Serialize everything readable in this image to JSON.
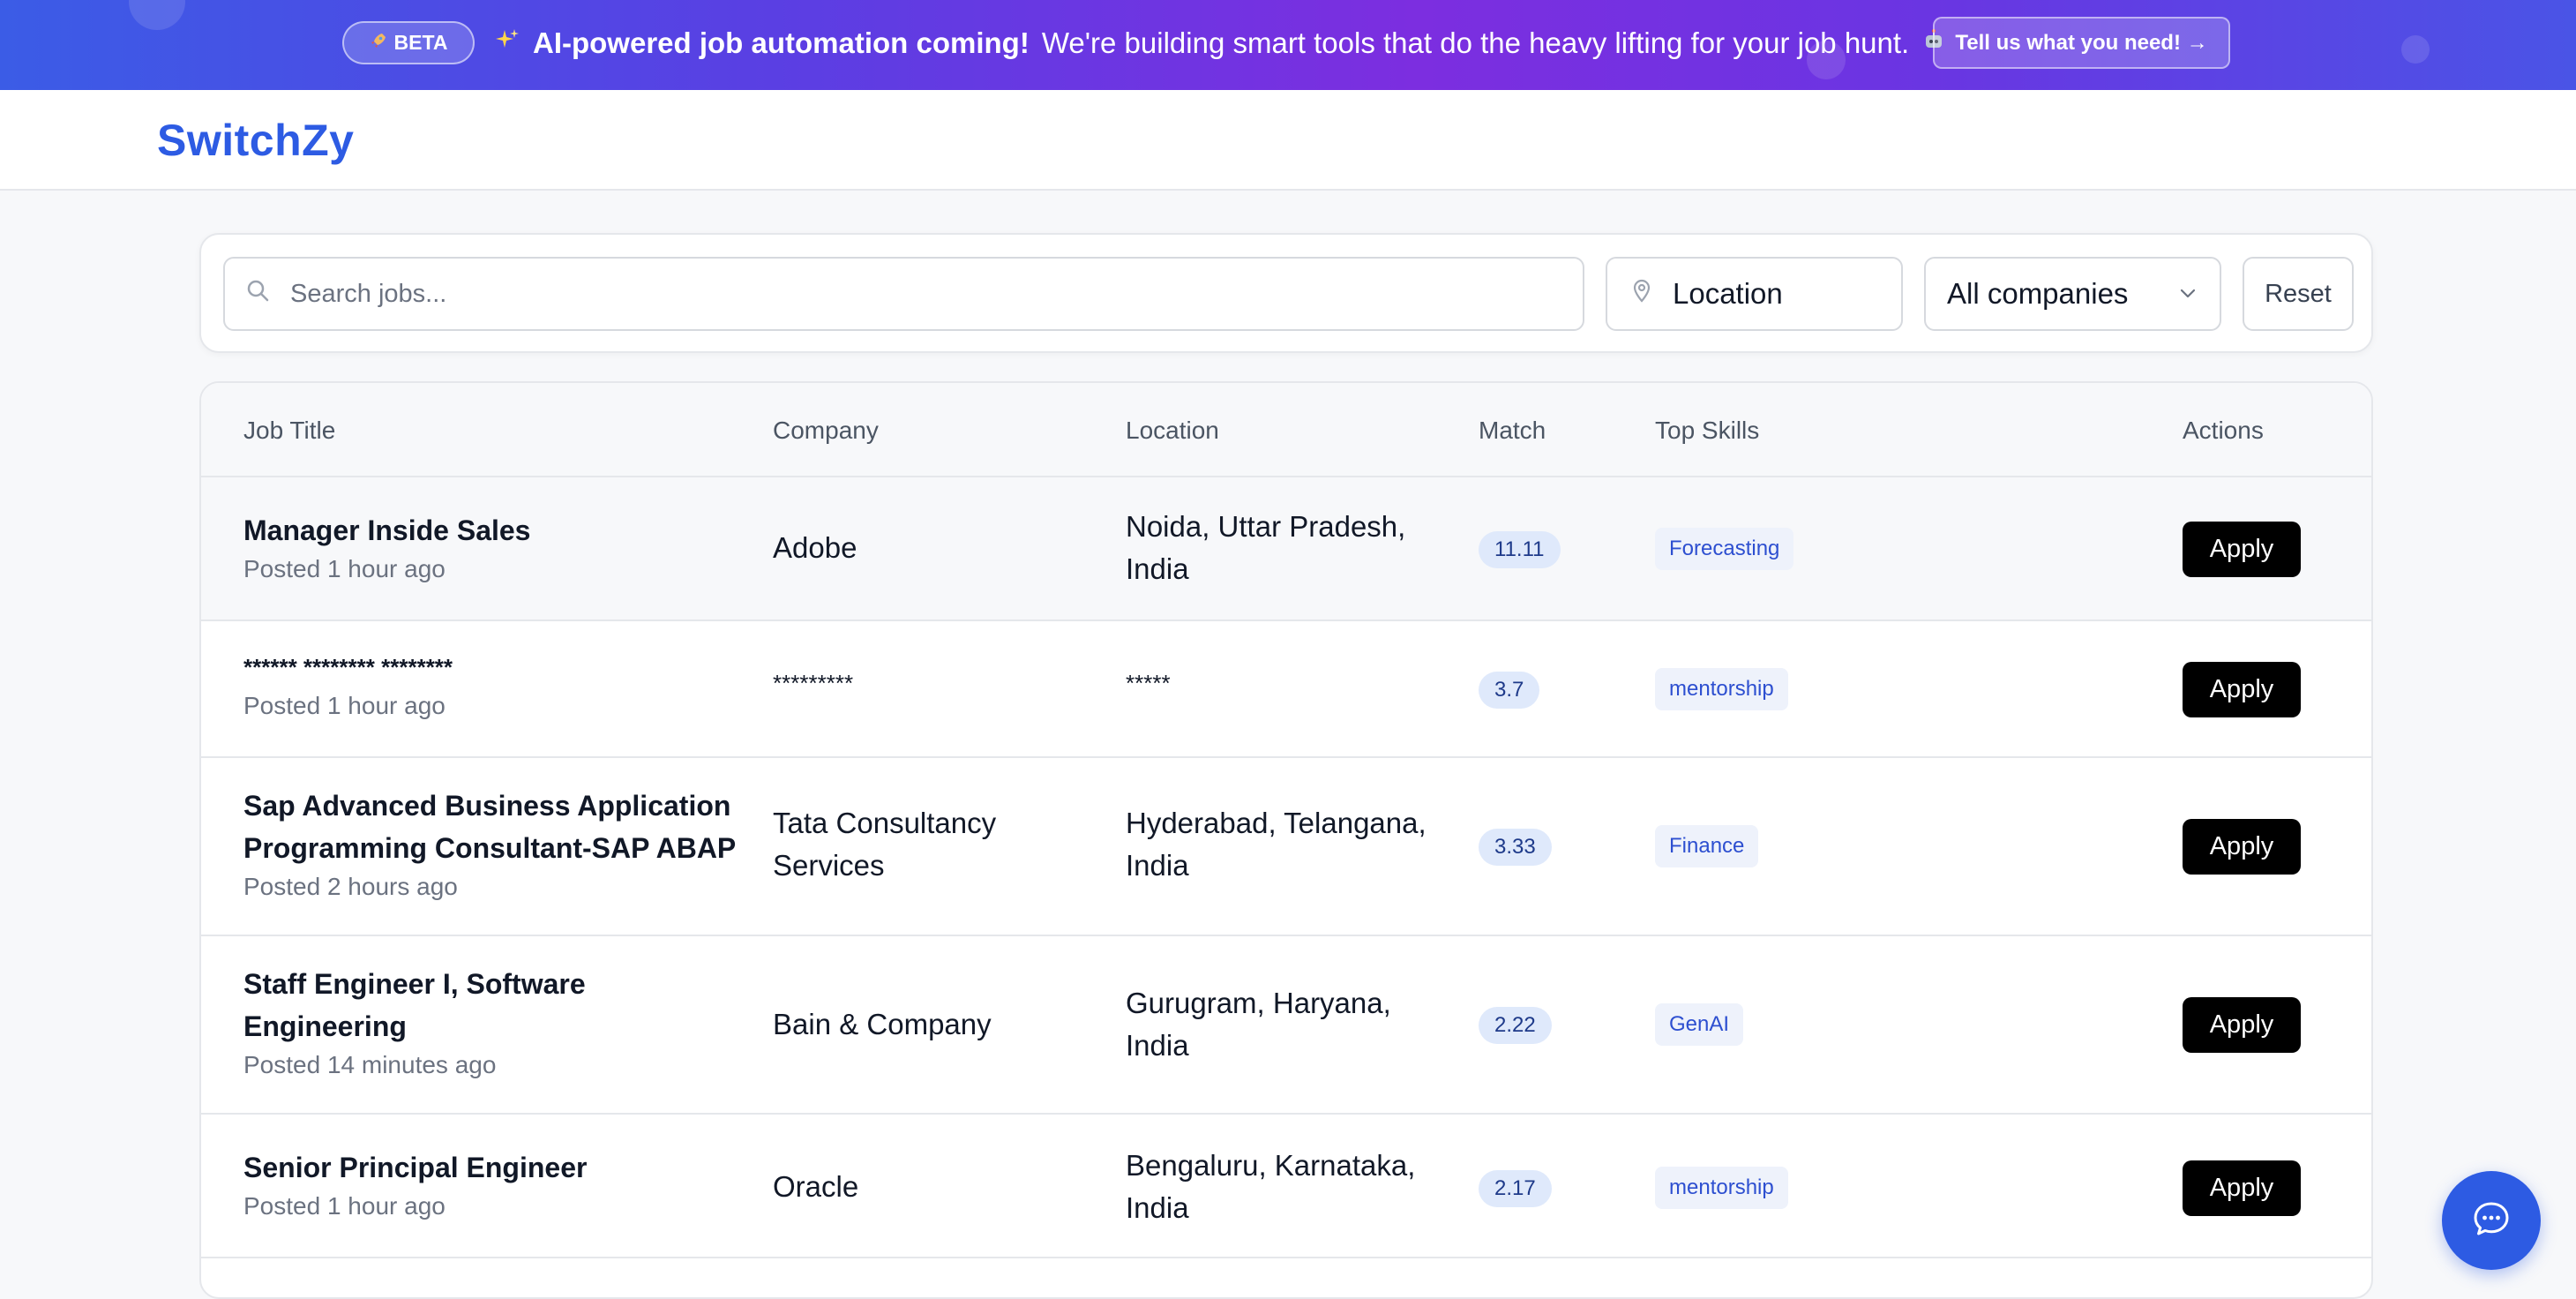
{
  "banner": {
    "beta_label": "BETA",
    "beta_icon": "rocket-icon",
    "sparkle_icon": "sparkles-icon",
    "headline": "AI-powered job automation coming!",
    "message": "We're building smart tools that do the heavy lifting for your job hunt.",
    "robot_icon": "robot-icon",
    "cta_label": "Tell us what you need! →"
  },
  "header": {
    "logo": "SwitchZy"
  },
  "filters": {
    "search_placeholder": "Search jobs...",
    "location_placeholder": "Location",
    "company_selected": "All companies",
    "reset_label": "Reset"
  },
  "table": {
    "columns": {
      "job_title": "Job Title",
      "company": "Company",
      "location": "Location",
      "match": "Match",
      "top_skills": "Top Skills",
      "actions": "Actions"
    },
    "rows": [
      {
        "title": "Manager Inside Sales",
        "posted": "Posted 1 hour ago",
        "company": "Adobe",
        "location": "Noida, Uttar Pradesh, India",
        "match": "11.11",
        "skill": "Forecasting",
        "action": "Apply"
      },
      {
        "title": "****** ******** ********",
        "posted": "Posted 1 hour ago",
        "company": "*********",
        "location": "*****",
        "match": "3.7",
        "skill": "mentorship",
        "action": "Apply"
      },
      {
        "title": "Sap Advanced Business Application Programming Consultant-SAP ABAP",
        "posted": "Posted 2 hours ago",
        "company": "Tata Consultancy Services",
        "location": "Hyderabad, Telangana, India",
        "match": "3.33",
        "skill": "Finance",
        "action": "Apply"
      },
      {
        "title": "Staff Engineer I, Software Engineering",
        "posted": "Posted 14 minutes ago",
        "company": "Bain & Company",
        "location": "Gurugram, Haryana, India",
        "match": "2.22",
        "skill": "GenAI",
        "action": "Apply"
      },
      {
        "title": "Senior Principal Engineer",
        "posted": "Posted 1 hour ago",
        "company": "Oracle",
        "location": "Bengaluru, Karnataka, India",
        "match": "2.17",
        "skill": "mentorship",
        "action": "Apply"
      }
    ]
  },
  "chat": {
    "icon": "chat-bubble-icon"
  },
  "colors": {
    "brand": "#2d5be3",
    "banner_start": "#3b5ce6",
    "banner_mid": "#7c2ee0",
    "apply_bg": "#000000",
    "match_bg": "#dfe9fb"
  }
}
